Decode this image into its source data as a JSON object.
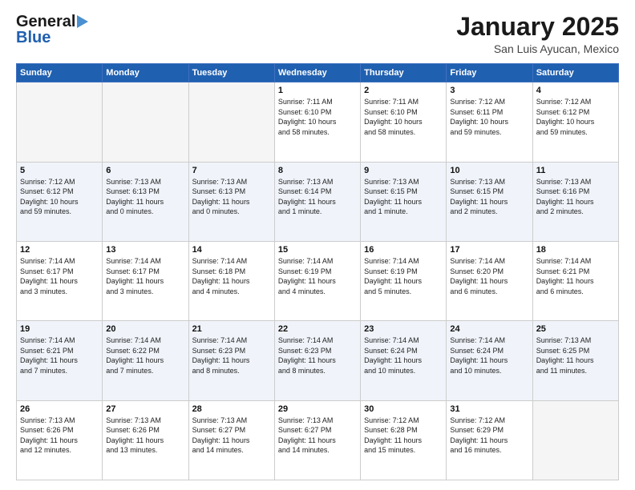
{
  "header": {
    "logo_line1": "General",
    "logo_line2": "Blue",
    "title": "January 2025",
    "subtitle": "San Luis Ayucan, Mexico"
  },
  "days_of_week": [
    "Sunday",
    "Monday",
    "Tuesday",
    "Wednesday",
    "Thursday",
    "Friday",
    "Saturday"
  ],
  "weeks": [
    [
      {
        "day": "",
        "info": ""
      },
      {
        "day": "",
        "info": ""
      },
      {
        "day": "",
        "info": ""
      },
      {
        "day": "1",
        "info": "Sunrise: 7:11 AM\nSunset: 6:10 PM\nDaylight: 10 hours\nand 58 minutes."
      },
      {
        "day": "2",
        "info": "Sunrise: 7:11 AM\nSunset: 6:10 PM\nDaylight: 10 hours\nand 58 minutes."
      },
      {
        "day": "3",
        "info": "Sunrise: 7:12 AM\nSunset: 6:11 PM\nDaylight: 10 hours\nand 59 minutes."
      },
      {
        "day": "4",
        "info": "Sunrise: 7:12 AM\nSunset: 6:12 PM\nDaylight: 10 hours\nand 59 minutes."
      }
    ],
    [
      {
        "day": "5",
        "info": "Sunrise: 7:12 AM\nSunset: 6:12 PM\nDaylight: 10 hours\nand 59 minutes."
      },
      {
        "day": "6",
        "info": "Sunrise: 7:13 AM\nSunset: 6:13 PM\nDaylight: 11 hours\nand 0 minutes."
      },
      {
        "day": "7",
        "info": "Sunrise: 7:13 AM\nSunset: 6:13 PM\nDaylight: 11 hours\nand 0 minutes."
      },
      {
        "day": "8",
        "info": "Sunrise: 7:13 AM\nSunset: 6:14 PM\nDaylight: 11 hours\nand 1 minute."
      },
      {
        "day": "9",
        "info": "Sunrise: 7:13 AM\nSunset: 6:15 PM\nDaylight: 11 hours\nand 1 minute."
      },
      {
        "day": "10",
        "info": "Sunrise: 7:13 AM\nSunset: 6:15 PM\nDaylight: 11 hours\nand 2 minutes."
      },
      {
        "day": "11",
        "info": "Sunrise: 7:13 AM\nSunset: 6:16 PM\nDaylight: 11 hours\nand 2 minutes."
      }
    ],
    [
      {
        "day": "12",
        "info": "Sunrise: 7:14 AM\nSunset: 6:17 PM\nDaylight: 11 hours\nand 3 minutes."
      },
      {
        "day": "13",
        "info": "Sunrise: 7:14 AM\nSunset: 6:17 PM\nDaylight: 11 hours\nand 3 minutes."
      },
      {
        "day": "14",
        "info": "Sunrise: 7:14 AM\nSunset: 6:18 PM\nDaylight: 11 hours\nand 4 minutes."
      },
      {
        "day": "15",
        "info": "Sunrise: 7:14 AM\nSunset: 6:19 PM\nDaylight: 11 hours\nand 4 minutes."
      },
      {
        "day": "16",
        "info": "Sunrise: 7:14 AM\nSunset: 6:19 PM\nDaylight: 11 hours\nand 5 minutes."
      },
      {
        "day": "17",
        "info": "Sunrise: 7:14 AM\nSunset: 6:20 PM\nDaylight: 11 hours\nand 6 minutes."
      },
      {
        "day": "18",
        "info": "Sunrise: 7:14 AM\nSunset: 6:21 PM\nDaylight: 11 hours\nand 6 minutes."
      }
    ],
    [
      {
        "day": "19",
        "info": "Sunrise: 7:14 AM\nSunset: 6:21 PM\nDaylight: 11 hours\nand 7 minutes."
      },
      {
        "day": "20",
        "info": "Sunrise: 7:14 AM\nSunset: 6:22 PM\nDaylight: 11 hours\nand 7 minutes."
      },
      {
        "day": "21",
        "info": "Sunrise: 7:14 AM\nSunset: 6:23 PM\nDaylight: 11 hours\nand 8 minutes."
      },
      {
        "day": "22",
        "info": "Sunrise: 7:14 AM\nSunset: 6:23 PM\nDaylight: 11 hours\nand 8 minutes."
      },
      {
        "day": "23",
        "info": "Sunrise: 7:14 AM\nSunset: 6:24 PM\nDaylight: 11 hours\nand 10 minutes."
      },
      {
        "day": "24",
        "info": "Sunrise: 7:14 AM\nSunset: 6:24 PM\nDaylight: 11 hours\nand 10 minutes."
      },
      {
        "day": "25",
        "info": "Sunrise: 7:13 AM\nSunset: 6:25 PM\nDaylight: 11 hours\nand 11 minutes."
      }
    ],
    [
      {
        "day": "26",
        "info": "Sunrise: 7:13 AM\nSunset: 6:26 PM\nDaylight: 11 hours\nand 12 minutes."
      },
      {
        "day": "27",
        "info": "Sunrise: 7:13 AM\nSunset: 6:26 PM\nDaylight: 11 hours\nand 13 minutes."
      },
      {
        "day": "28",
        "info": "Sunrise: 7:13 AM\nSunset: 6:27 PM\nDaylight: 11 hours\nand 14 minutes."
      },
      {
        "day": "29",
        "info": "Sunrise: 7:13 AM\nSunset: 6:27 PM\nDaylight: 11 hours\nand 14 minutes."
      },
      {
        "day": "30",
        "info": "Sunrise: 7:12 AM\nSunset: 6:28 PM\nDaylight: 11 hours\nand 15 minutes."
      },
      {
        "day": "31",
        "info": "Sunrise: 7:12 AM\nSunset: 6:29 PM\nDaylight: 11 hours\nand 16 minutes."
      },
      {
        "day": "",
        "info": ""
      }
    ]
  ]
}
